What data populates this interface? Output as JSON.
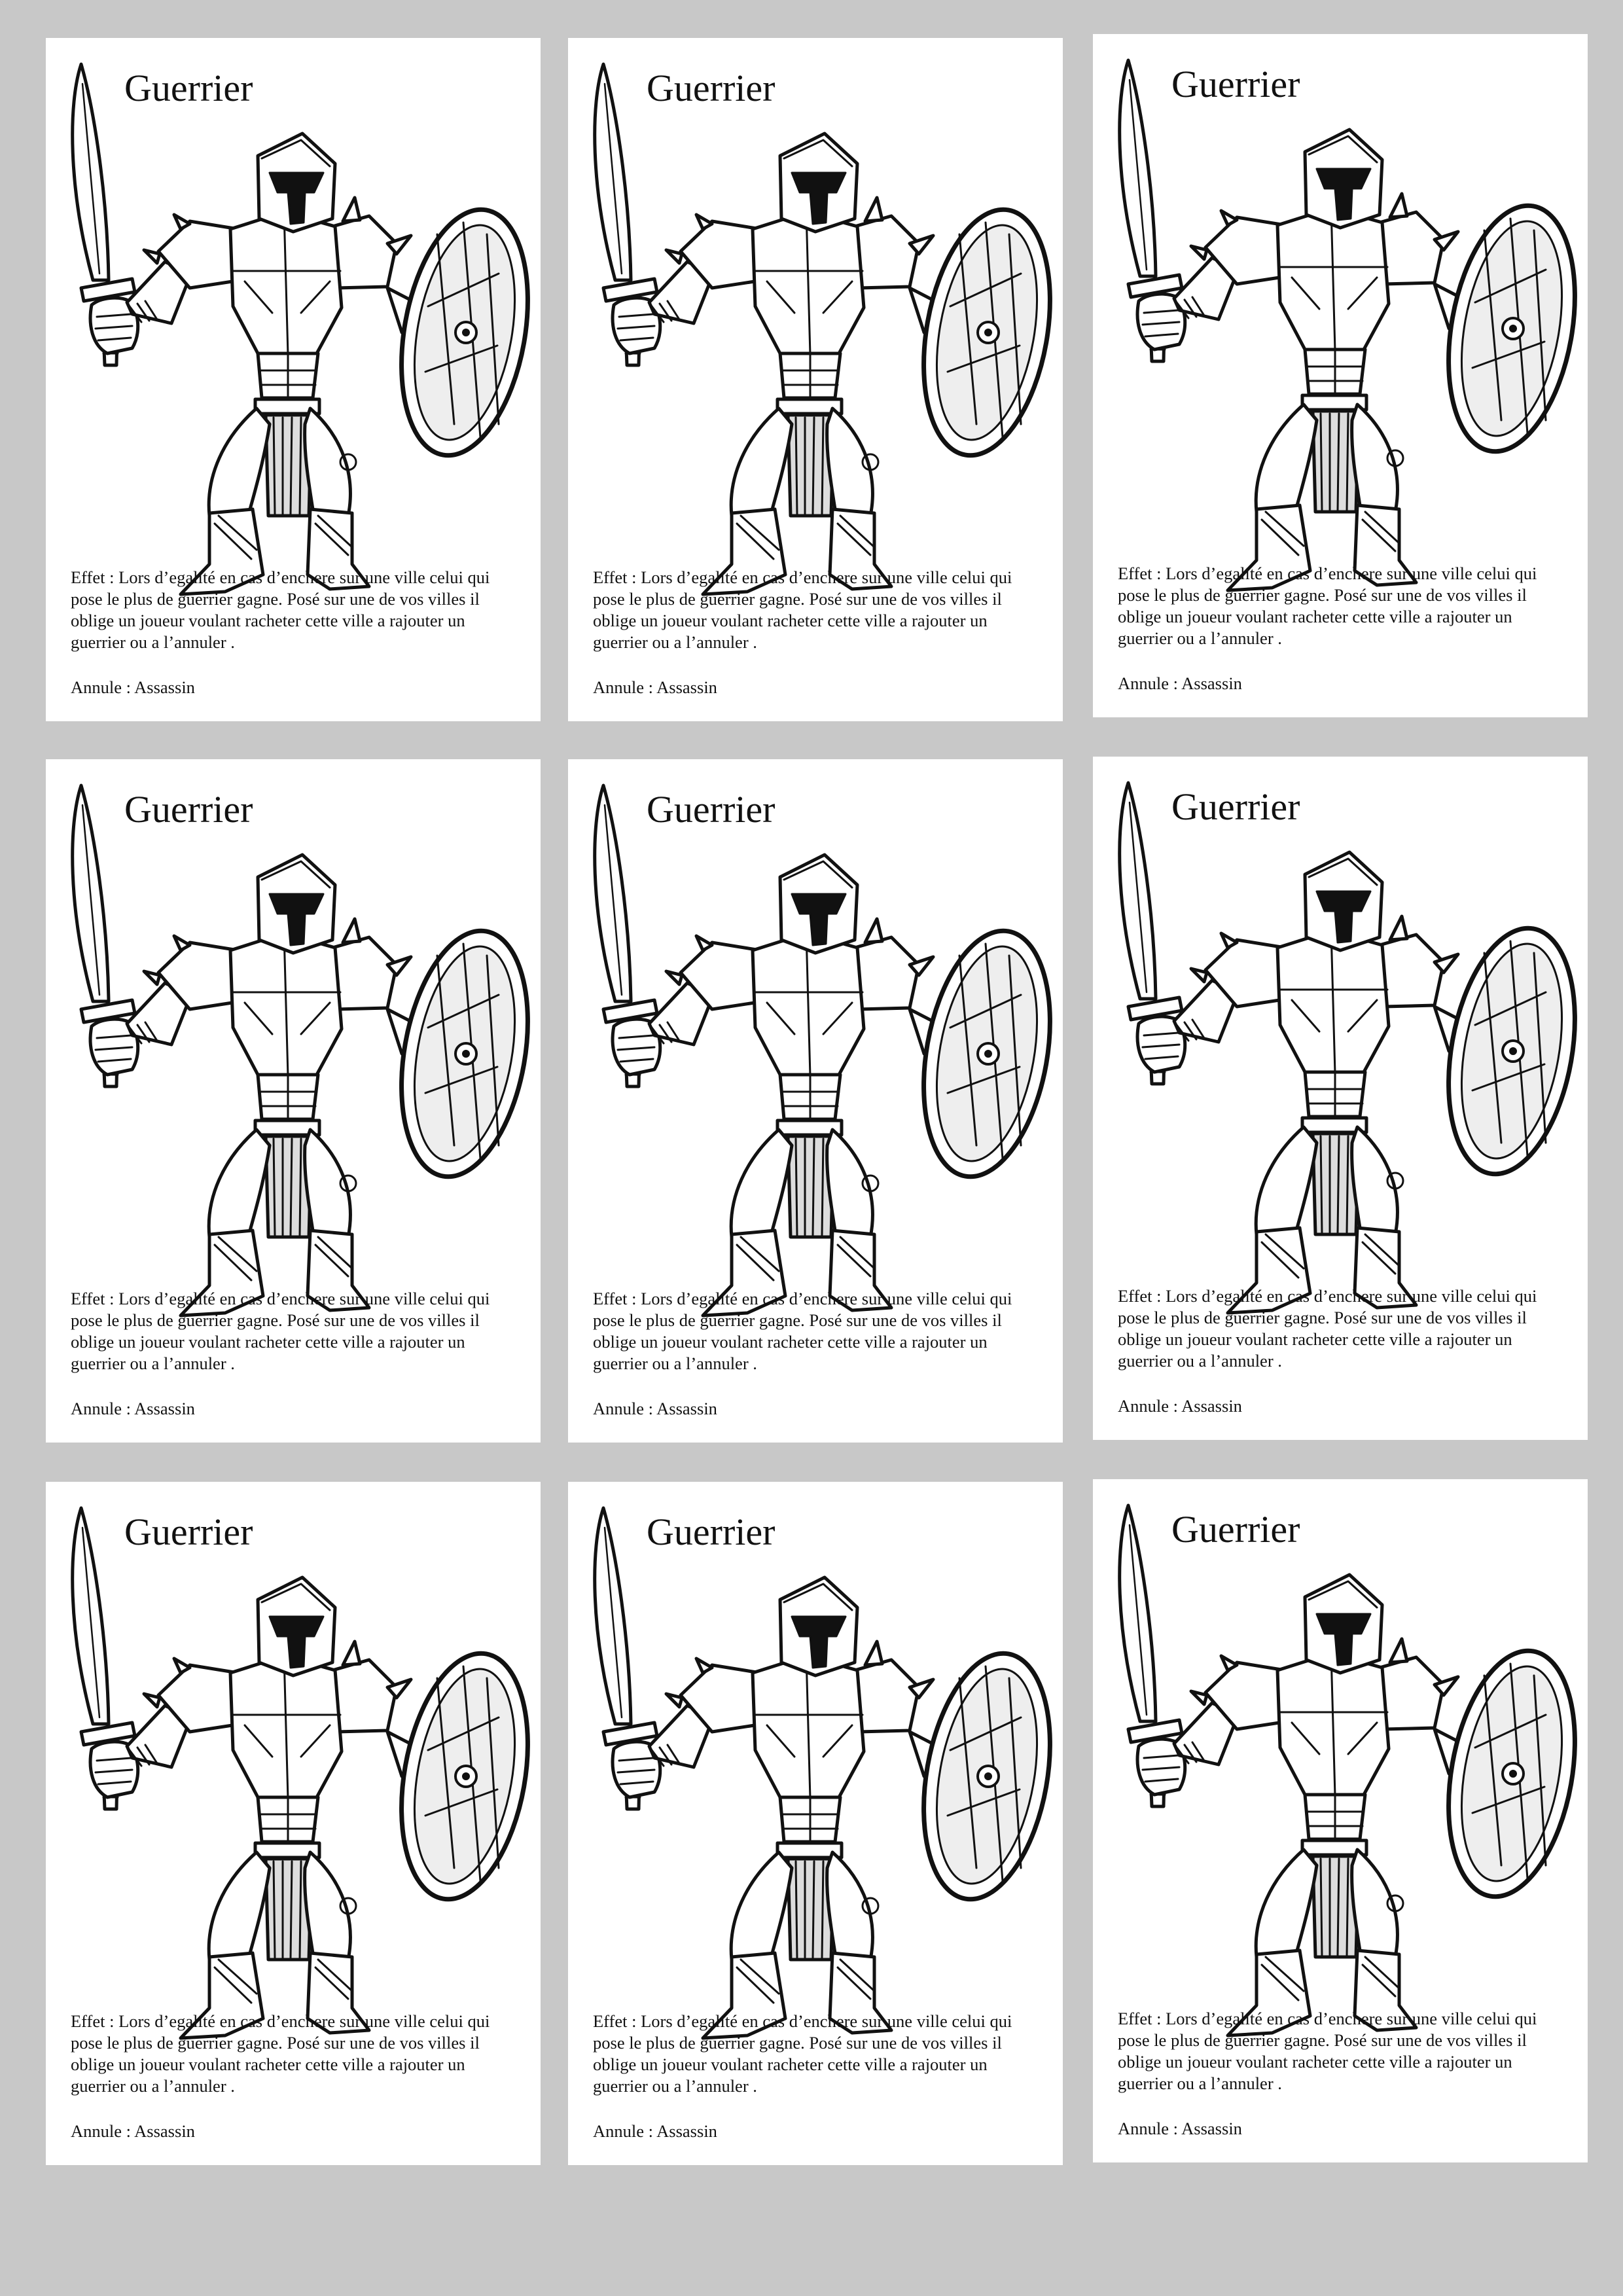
{
  "page": {
    "background": "#c8c8c8",
    "card_background": "#ffffff",
    "ink": "#111111"
  },
  "cards": [
    {
      "title": "Guerrier",
      "effect": "Effet : Lors d’egalité en cas d’enchere sur une ville celui qui pose le plus de guerrier gagne. Posé sur une de vos villes il oblige un joueur voulant racheter cette ville a rajouter un guerrier ou a l’annuler .",
      "counter": "Annule : Assassin",
      "illustration": "warrior-with-sword-and-shield"
    },
    {
      "title": "Guerrier",
      "effect": "Effet : Lors d’egalité en cas d’enchere sur une ville celui qui pose le plus de guerrier gagne. Posé sur une de vos villes il oblige un joueur voulant racheter cette ville a rajouter un guerrier ou a l’annuler .",
      "counter": "Annule : Assassin",
      "illustration": "warrior-with-sword-and-shield"
    },
    {
      "title": "Guerrier",
      "effect": "Effet : Lors d’egalité en cas d’enchere sur une ville celui qui pose le plus de guerrier gagne. Posé sur une de vos villes il oblige un joueur voulant racheter cette ville a rajouter un guerrier ou a l’annuler .",
      "counter": "Annule : Assassin",
      "illustration": "warrior-with-sword-and-shield"
    },
    {
      "title": "Guerrier",
      "effect": "Effet : Lors d’egalité en cas d’enchere sur une ville celui qui pose le plus de guerrier gagne. Posé sur une de vos villes il oblige un joueur voulant racheter cette ville a rajouter un guerrier ou a l’annuler .",
      "counter": "Annule : Assassin",
      "illustration": "warrior-with-sword-and-shield"
    },
    {
      "title": "Guerrier",
      "effect": "Effet : Lors d’egalité en cas d’enchere sur une ville celui qui pose le plus de guerrier gagne. Posé sur une de vos villes il oblige un joueur voulant racheter cette ville a rajouter un guerrier ou a l’annuler .",
      "counter": "Annule : Assassin",
      "illustration": "warrior-with-sword-and-shield"
    },
    {
      "title": "Guerrier",
      "effect": "Effet : Lors d’egalité en cas d’enchere sur une ville celui qui pose le plus de guerrier gagne. Posé sur une de vos villes il oblige un joueur voulant racheter cette ville a rajouter un guerrier ou a l’annuler .",
      "counter": "Annule : Assassin",
      "illustration": "warrior-with-sword-and-shield"
    },
    {
      "title": "Guerrier",
      "effect": "Effet : Lors d’egalité en cas d’enchere sur une ville celui qui pose le plus de guerrier gagne. Posé sur une de vos villes il oblige un joueur voulant racheter cette ville a rajouter un guerrier ou a l’annuler .",
      "counter": "Annule : Assassin",
      "illustration": "warrior-with-sword-and-shield"
    },
    {
      "title": "Guerrier",
      "effect": "Effet : Lors d’egalité en cas d’enchere sur une ville celui qui pose le plus de guerrier gagne. Posé sur une de vos villes il oblige un joueur voulant racheter cette ville a rajouter un guerrier ou a l’annuler .",
      "counter": "Annule : Assassin",
      "illustration": "warrior-with-sword-and-shield"
    },
    {
      "title": "Guerrier",
      "effect": "Effet : Lors d’egalité en cas d’enchere sur une ville celui qui pose le plus de guerrier gagne. Posé sur une de vos villes il oblige un joueur voulant racheter cette ville a rajouter un guerrier ou a l’annuler .",
      "counter": "Annule : Assassin",
      "illustration": "warrior-with-sword-and-shield"
    }
  ]
}
